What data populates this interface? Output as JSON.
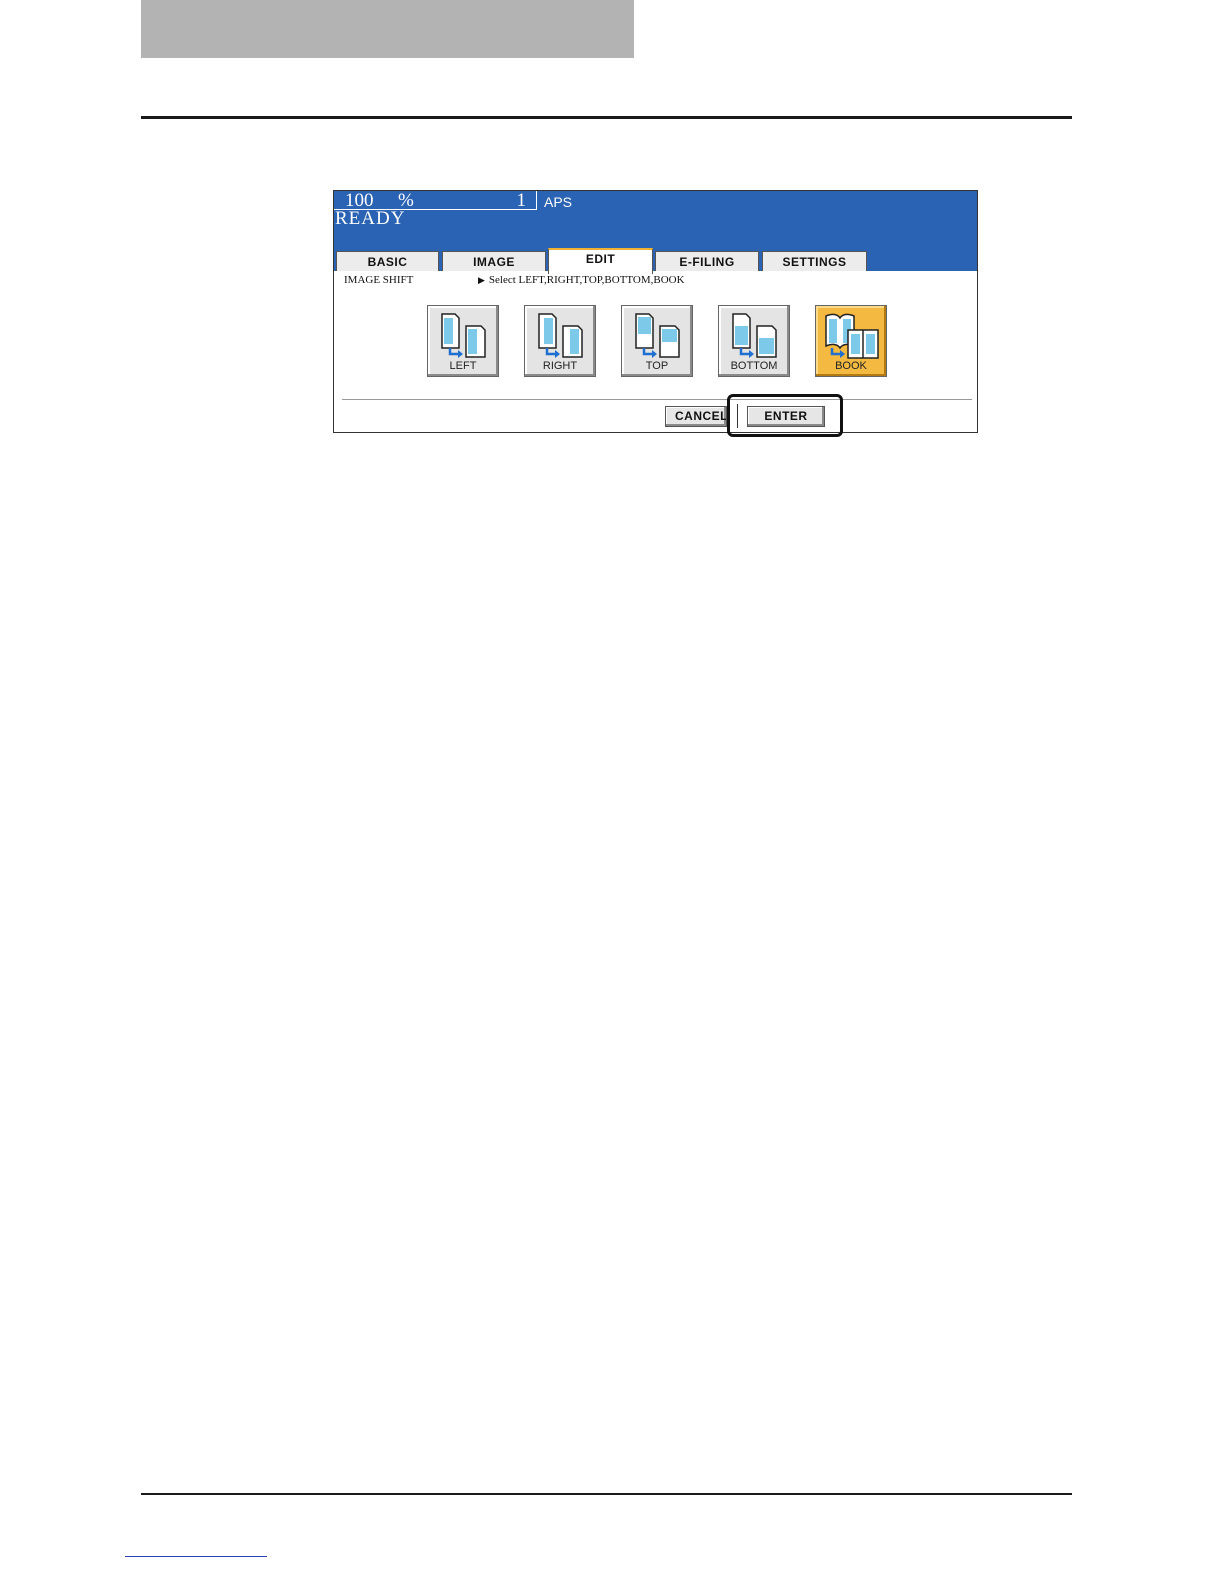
{
  "panel": {
    "status": {
      "zoom_value": "100",
      "zoom_unit": "%",
      "copies": "1",
      "paper_mode": "APS",
      "state": "READY"
    },
    "tabs": [
      {
        "label": "BASIC"
      },
      {
        "label": "IMAGE"
      },
      {
        "label": "EDIT",
        "active": true
      },
      {
        "label": "E-FILING"
      },
      {
        "label": "SETTINGS"
      }
    ],
    "function_label": "IMAGE SHIFT",
    "instruction": "Select LEFT,RIGHT,TOP,BOTTOM,BOOK",
    "options": [
      {
        "label": "LEFT",
        "icon": "left-shift-icon"
      },
      {
        "label": "RIGHT",
        "icon": "right-shift-icon"
      },
      {
        "label": "TOP",
        "icon": "top-shift-icon"
      },
      {
        "label": "BOTTOM",
        "icon": "bottom-shift-icon"
      },
      {
        "label": "BOOK",
        "icon": "book-shift-icon",
        "selected": true
      }
    ],
    "buttons": {
      "cancel_label": "CANCEL",
      "enter_label": "ENTER"
    },
    "colors": {
      "status_bar": "#2a62b4",
      "selected_option": "#f4b940",
      "active_tab_accent": "#f0b030"
    }
  }
}
